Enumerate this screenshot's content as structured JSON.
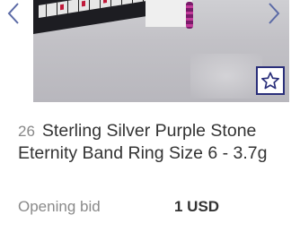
{
  "listing": {
    "lot_number": "26",
    "title": "Sterling Silver Purple Stone Eternity Band Ring Size 6 - 3.7g",
    "bid_label": "Opening bid",
    "bid_value": "1 USD"
  },
  "carousel": {
    "prev_icon": "chevron-left-icon",
    "next_icon": "chevron-right-icon"
  },
  "favorite": {
    "icon": "star-icon"
  },
  "colors": {
    "accent": "#2a2f7a",
    "nav_chevron": "#5b6aa6"
  }
}
